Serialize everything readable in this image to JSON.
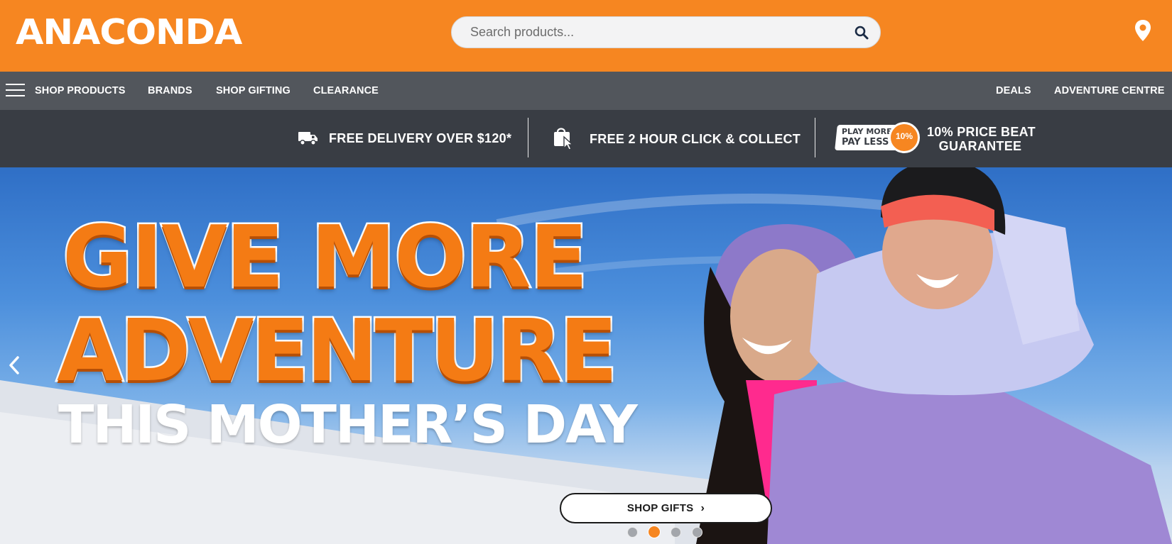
{
  "header": {
    "logo_text": "ANACONDA",
    "search_placeholder": "Search products...",
    "search_icon": "search-icon",
    "location_icon": "map-pin-icon",
    "brand_color": "#f68621"
  },
  "nav": {
    "menu_icon": "hamburger-menu-icon",
    "left_items": [
      "SHOP PRODUCTS",
      "BRANDS",
      "SHOP GIFTING",
      "CLEARANCE"
    ],
    "right_items": [
      "DEALS",
      "ADVENTURE CENTRE"
    ]
  },
  "benefits": {
    "delivery_text": "FREE DELIVERY OVER $120*",
    "delivery_icon": "truck-icon",
    "collect_text": "FREE 2 HOUR CLICK & COLLECT",
    "collect_icon": "shopping-bag-click-icon",
    "price_badge_line1": "PLAY MORE",
    "price_badge_line2": "PAY LESS",
    "price_badge_percent": "10%",
    "price_text_line1": "10% PRICE BEAT",
    "price_text_line2": "GUARANTEE"
  },
  "hero": {
    "line1": "GIVE MORE",
    "line2": "ADVENTURE",
    "line3": "THIS MOTHER’S DAY",
    "cta_label": "SHOP GIFTS",
    "active_slide": 2,
    "slide_count": 4
  }
}
